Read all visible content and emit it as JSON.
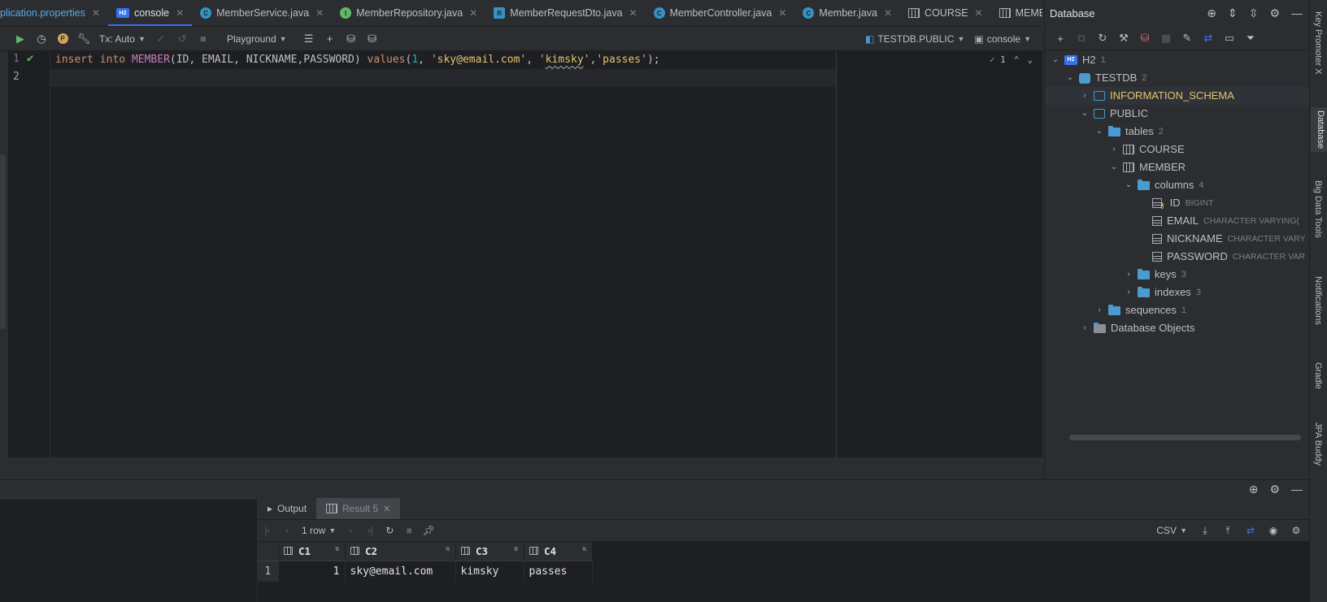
{
  "tabs": [
    {
      "label": "plication.properties",
      "icon": "none",
      "active": false
    },
    {
      "label": "console",
      "icon": "h2-icon",
      "active": true
    },
    {
      "label": "MemberService.java",
      "icon": "class-icon",
      "active": false
    },
    {
      "label": "MemberRepository.java",
      "icon": "interface-icon",
      "active": false
    },
    {
      "label": "MemberRequestDto.java",
      "icon": "record-icon",
      "active": false
    },
    {
      "label": "MemberController.java",
      "icon": "class-icon",
      "active": false
    },
    {
      "label": "Member.java",
      "icon": "class-icon",
      "active": false
    },
    {
      "label": "COURSE",
      "icon": "table-icon",
      "active": false
    },
    {
      "label": "MEMBER",
      "icon": "table-icon",
      "active": false
    }
  ],
  "toolbar": {
    "tx_mode": "Tx: Auto",
    "playground": "Playground",
    "schema": "TESTDB.PUBLIC",
    "session": "console"
  },
  "editor": {
    "line1_number": "1",
    "line2_number": "2",
    "code": {
      "kw_insert": "insert",
      "kw_into": "into",
      "table": "MEMBER",
      "col_open": "(ID, EMAIL, NICKNAME,PASSWORD)",
      "kw_values": "values",
      "v_open": "(",
      "v_num": "1",
      "v_sep1": ", ",
      "v_email": "'sky@email.com'",
      "v_sep2": ", ",
      "v_q1": "'",
      "v_nick": "kimsky",
      "v_q2": "'",
      "v_sep3": ",",
      "v_pass": "'passes'",
      "v_close": ");"
    },
    "inspection_count": "1"
  },
  "database_panel": {
    "title": "Database",
    "tree": [
      {
        "label": "H2",
        "count": "1"
      },
      {
        "label": "TESTDB",
        "count": "2"
      },
      {
        "label": "INFORMATION_SCHEMA",
        "count": ""
      },
      {
        "label": "PUBLIC",
        "count": ""
      },
      {
        "label": "tables",
        "count": "2"
      },
      {
        "label": "COURSE",
        "count": ""
      },
      {
        "label": "MEMBER",
        "count": ""
      },
      {
        "label": "columns",
        "count": "4"
      },
      {
        "label": "ID",
        "type": "BIGINT"
      },
      {
        "label": "EMAIL",
        "type": "CHARACTER VARYING("
      },
      {
        "label": "NICKNAME",
        "type": "CHARACTER VARY"
      },
      {
        "label": "PASSWORD",
        "type": "CHARACTER VAR"
      },
      {
        "label": "keys",
        "count": "3"
      },
      {
        "label": "indexes",
        "count": "3"
      },
      {
        "label": "sequences",
        "count": "1"
      },
      {
        "label": "Database Objects",
        "count": ""
      }
    ]
  },
  "right_stripe": [
    "Key Promoter X",
    "Database",
    "Big Data Tools",
    "Notifications",
    "Gradle",
    "JPA Buddy"
  ],
  "results": {
    "tabs": [
      {
        "label": "Output"
      },
      {
        "label": "Result 5"
      }
    ],
    "rows_label": "1 row",
    "export_format": "CSV",
    "columns": [
      "C1",
      "C2",
      "C3",
      "C4"
    ],
    "rows": [
      {
        "num": "1",
        "cells": [
          "1",
          "sky@email.com",
          "kimsky",
          "passes"
        ]
      }
    ]
  }
}
